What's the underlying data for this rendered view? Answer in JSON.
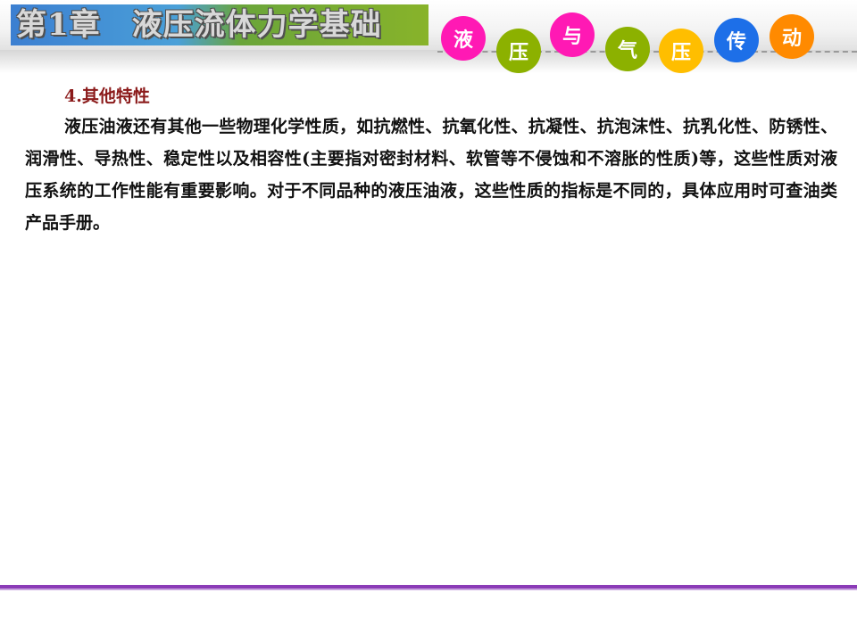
{
  "header": {
    "chapter_title": "第1章　液压流体力学基础",
    "book_chars": [
      {
        "char": "液",
        "color": "#ff19b4"
      },
      {
        "char": "压",
        "color": "#8cb100"
      },
      {
        "char": "与",
        "color": "#ff19b4"
      },
      {
        "char": "气",
        "color": "#8cb100"
      },
      {
        "char": "压",
        "color": "#ffbe00"
      },
      {
        "char": "传",
        "color": "#1d6fe8"
      },
      {
        "char": "动",
        "color": "#ff8a00"
      }
    ]
  },
  "content": {
    "section_heading": "4.其他特性",
    "paragraph": "液压油液还有其他一些物理化学性质，如抗燃性、抗氧化性、抗凝性、抗泡沫性、抗乳化性、防锈性、润滑性、导热性、稳定性以及相容性(主要指对密封材料、软管等不侵蚀和不溶胀的性质)等，这些性质对液压系统的工作性能有重要影响。对于不同品种的液压油液，这些性质的指标是不同的，具体应用时可查油类产品手册。"
  },
  "colors": {
    "heading": "#8b1a1a",
    "footer_line": "#8b3bb7"
  }
}
